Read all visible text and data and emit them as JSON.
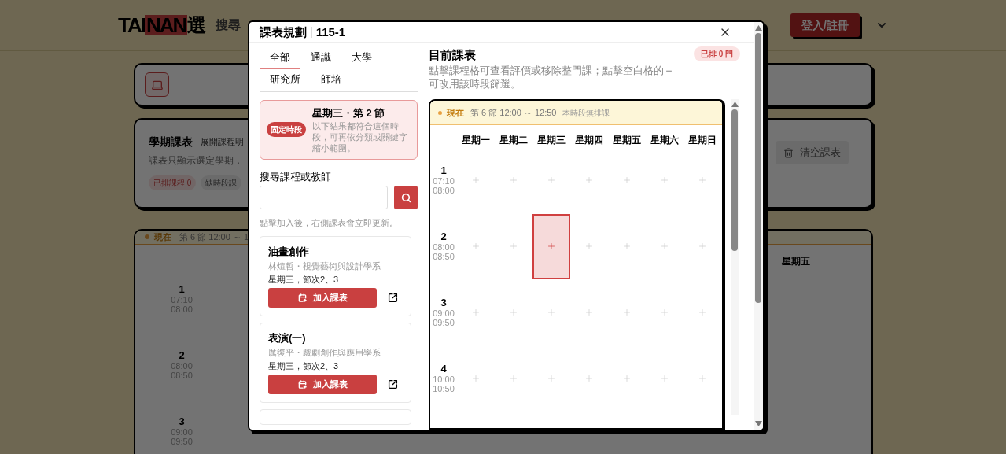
{
  "page": {
    "logo": [
      "TAI",
      "NAN",
      "選"
    ],
    "nav": [
      {
        "label": "搜尋"
      }
    ],
    "login": "登入/註冊",
    "semester_card": {
      "title": "學期課表",
      "toggle": "展開課程明",
      "description": "課表只顯示選定學期，",
      "badges": [
        {
          "label": "已排課程 0",
          "kind": "scheduled"
        },
        {
          "label": "缺時段課",
          "kind": "missing"
        }
      ],
      "clear_button": "清空課表"
    },
    "timetable_card": {
      "now_label": "現在",
      "now_text": "第 6 節 12:00 ～ 1",
      "day_header": "星期五",
      "periods": [
        {
          "number": "1",
          "start": "07:10",
          "end": "08:00"
        },
        {
          "number": "2",
          "start": "08:00",
          "end": "08:50"
        },
        {
          "number": "3",
          "start": "09:00",
          "end": "09:50"
        }
      ]
    }
  },
  "modal": {
    "title": "課表規劃",
    "separator": "|",
    "term": "115-1",
    "tabs": [
      [
        {
          "label": "全部",
          "selected": true
        },
        {
          "label": "通識",
          "selected": false
        },
        {
          "label": "大學",
          "selected": false
        }
      ],
      [
        {
          "label": "研究所",
          "selected": false
        },
        {
          "label": "師培",
          "selected": false
        }
      ]
    ],
    "slot": {
      "badge": "固定時段",
      "title": "星期三・第 2 節",
      "description": "以下結果都符合這個時段，可再依分類或關鍵字縮小範圍。"
    },
    "search": {
      "label": "搜尋課程或教師"
    },
    "hint": "點擊加入後，右側課表會立即更新。",
    "courses": [
      {
        "name": "油畫創作",
        "teacher": "林煊哲・視覺藝術與設計學系",
        "time": "星期三，節次2、3",
        "button": "加入課表"
      },
      {
        "name": "表演(一)",
        "teacher": "厲復平・戲劇創作與應用學系",
        "time": "星期三，節次2、3",
        "button": "加入課表"
      }
    ],
    "schedule": {
      "title": "目前課表",
      "description": "點擊課程格可查看評價或移除整門課；點擊空白格的＋可改用該時段篩選。",
      "count": "已排 0 門",
      "now_label": "現在",
      "now_text": "第 6 節 12:00 ～ 12:50",
      "now_note": "本時段無排課",
      "days": [
        "星期一",
        "星期二",
        "星期三",
        "星期四",
        "星期五",
        "星期六",
        "星期日"
      ],
      "periods": [
        {
          "number": "1",
          "start": "07:10",
          "end": "08:00",
          "cells": [
            {
              "selected": false
            },
            {
              "selected": false
            },
            {
              "selected": false
            },
            {
              "selected": false
            },
            {
              "selected": false
            },
            {
              "selected": false
            },
            {
              "selected": false
            }
          ]
        },
        {
          "number": "2",
          "start": "08:00",
          "end": "08:50",
          "cells": [
            {
              "selected": false
            },
            {
              "selected": false
            },
            {
              "selected": true
            },
            {
              "selected": false
            },
            {
              "selected": false
            },
            {
              "selected": false
            },
            {
              "selected": false
            }
          ]
        },
        {
          "number": "3",
          "start": "09:00",
          "end": "09:50",
          "cells": [
            {
              "selected": false
            },
            {
              "selected": false
            },
            {
              "selected": false
            },
            {
              "selected": false
            },
            {
              "selected": false
            },
            {
              "selected": false
            },
            {
              "selected": false
            }
          ]
        },
        {
          "number": "4",
          "start": "10:00",
          "end": "10:50",
          "cells": [
            {
              "selected": false
            },
            {
              "selected": false
            },
            {
              "selected": false
            },
            {
              "selected": false
            },
            {
              "selected": false
            },
            {
              "selected": false
            },
            {
              "selected": false
            }
          ]
        }
      ]
    }
  }
}
